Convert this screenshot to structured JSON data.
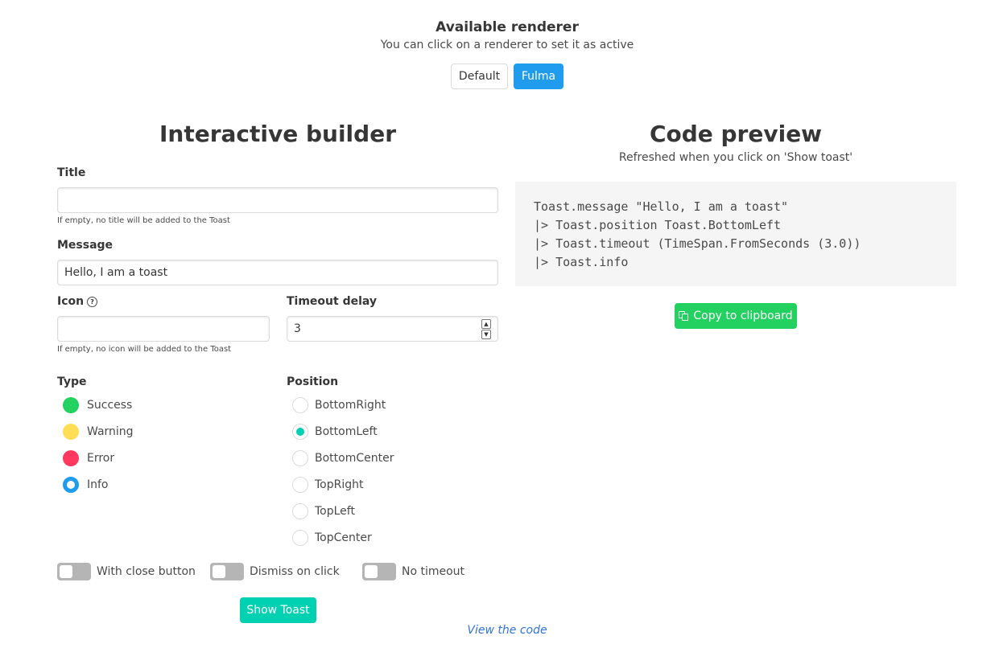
{
  "renderer": {
    "title": "Available renderer",
    "subtitle": "You can click on a renderer to set it as active",
    "buttons": [
      "Default",
      "Fulma"
    ]
  },
  "builder": {
    "heading": "Interactive builder",
    "title_label": "Title",
    "title_value": "",
    "title_help": "If empty, no title will be added to the Toast",
    "message_label": "Message",
    "message_value": "Hello, I am a toast",
    "icon_label": "Icon",
    "icon_help_glyph": "?",
    "icon_value": "",
    "icon_help": "If empty, no icon will be added to the Toast",
    "timeout_label": "Timeout delay",
    "timeout_value": "3",
    "spinner_up": "▲",
    "spinner_down": "▼",
    "type_label": "Type",
    "types": [
      "Success",
      "Warning",
      "Error",
      "Info"
    ],
    "selected_type": "Info",
    "type_colors": {
      "Success": "#23d160",
      "Warning": "#ffdd57",
      "Error": "#ff3860",
      "Info": "#209cee"
    },
    "position_label": "Position",
    "positions": [
      "BottomRight",
      "BottomLeft",
      "BottomCenter",
      "TopRight",
      "TopLeft",
      "TopCenter"
    ],
    "selected_position": "BottomLeft",
    "switches": [
      "With close button",
      "Dismiss on click",
      "No timeout"
    ],
    "switch_states": [
      false,
      false,
      false
    ],
    "show_button": "Show Toast"
  },
  "preview": {
    "heading": "Code preview",
    "subtitle": "Refreshed when you click on 'Show toast'",
    "code": [
      "Toast.message \"Hello, I am a toast\"",
      "|> Toast.position Toast.BottomLeft",
      "|> Toast.timeout (TimeSpan.FromSeconds (3.0))",
      "|> Toast.info"
    ],
    "copy_button": "Copy to clipboard"
  },
  "footer": {
    "view_code": "View the code"
  }
}
